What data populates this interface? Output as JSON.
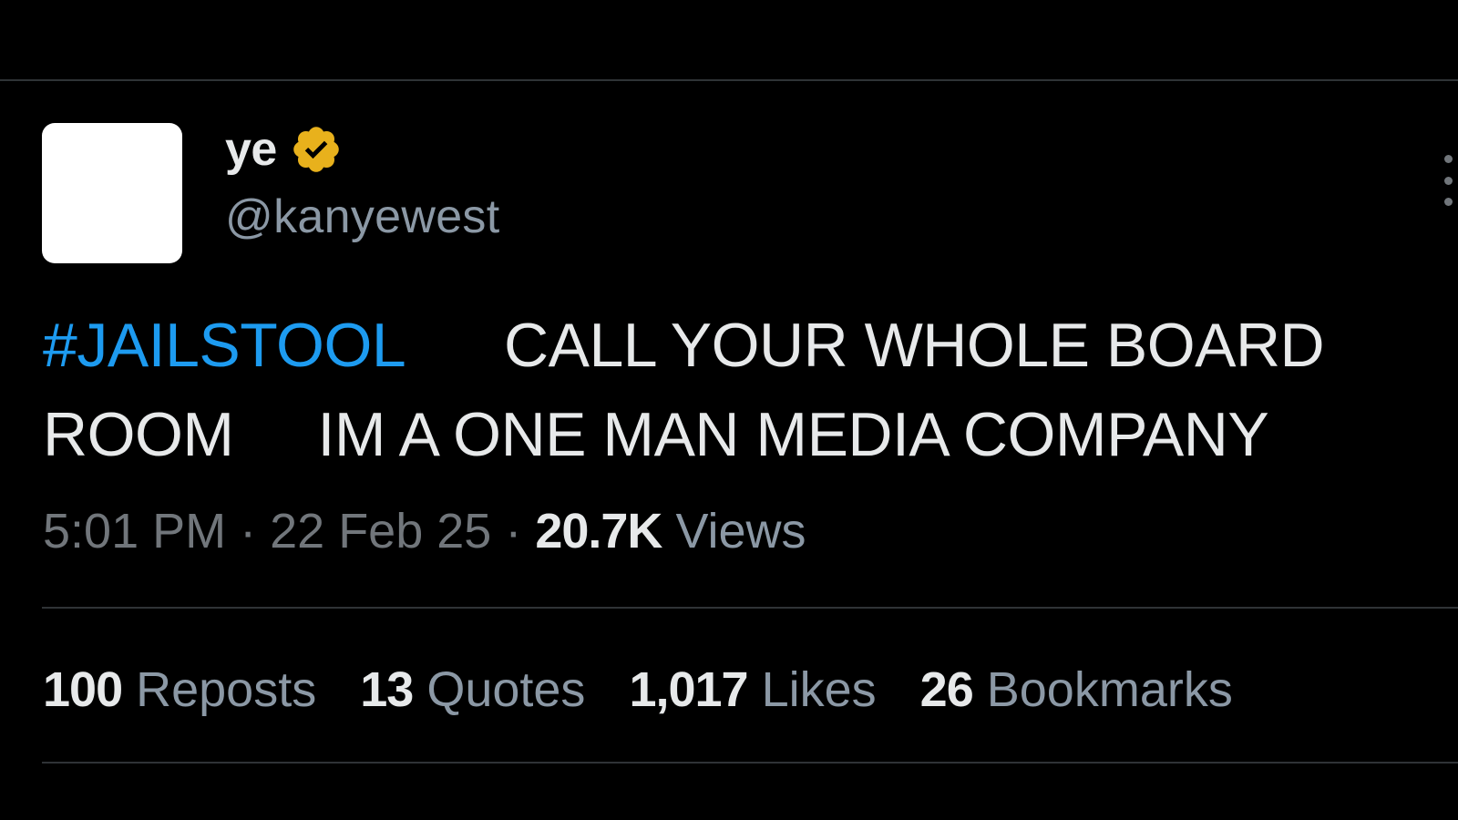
{
  "colors": {
    "background": "#000000",
    "text_primary": "#e7e9ea",
    "text_secondary": "#71767b",
    "hashtag": "#1d9bf0",
    "badge": "#e8b11c"
  },
  "author": {
    "display_name": "ye",
    "handle": "@kanyewest",
    "badge_icon": "verified-gold-badge-icon",
    "avatar": "white-square-avatar"
  },
  "post": {
    "hashtag": "#JAILSTOOL",
    "text": "      CALL YOUR WHOLE BOARD ROOM     IM A ONE MAN MEDIA COMPANY",
    "time": "5:01 PM",
    "separator": "·",
    "date": "22 Feb 25",
    "views_count": "20.7K",
    "views_label": "Views"
  },
  "stats": {
    "reposts_count": "100",
    "reposts_label": "Reposts",
    "quotes_count": "13",
    "quotes_label": "Quotes",
    "likes_count": "1,017",
    "likes_label": "Likes",
    "bookmarks_count": "26",
    "bookmarks_label": "Bookmarks"
  },
  "more_icon": "more-vertical-icon"
}
